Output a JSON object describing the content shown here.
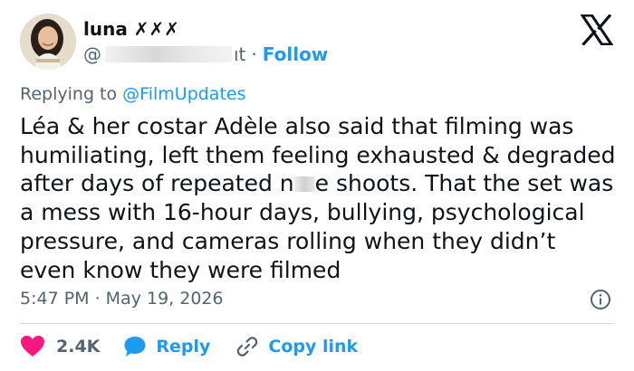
{
  "author": {
    "display_name": "luna ✗✗✗",
    "handle_prefix": "@",
    "handle_suffix": "ıt",
    "follow_label": "Follow",
    "separator": "·"
  },
  "reply": {
    "prefix": "Replying to",
    "target": "@FilmUpdates"
  },
  "tweet": {
    "text_before_censor": "Léa & her costar Adèle also said that filming was humiliating, left them feeling exhausted & degraded after days of repeated n",
    "text_after_censor": "e shoots. That the set was a mess with 16-hour days, bullying, psychological pressure, and cameras rolling when they didn’t even know they were filmed"
  },
  "timestamp": "5:47 PM · May 19, 2026",
  "actions": {
    "like_count": "2.4K",
    "reply_label": "Reply",
    "copy_label": "Copy link"
  },
  "colors": {
    "accent": "#1d9bf0",
    "like": "#f91880",
    "secondary_text": "#536471",
    "text": "#0f1419",
    "divider": "#cfd9de"
  },
  "icons": [
    "avatar",
    "x-logo-icon",
    "info-icon",
    "heart-icon",
    "reply-bubble-icon",
    "link-icon"
  ]
}
